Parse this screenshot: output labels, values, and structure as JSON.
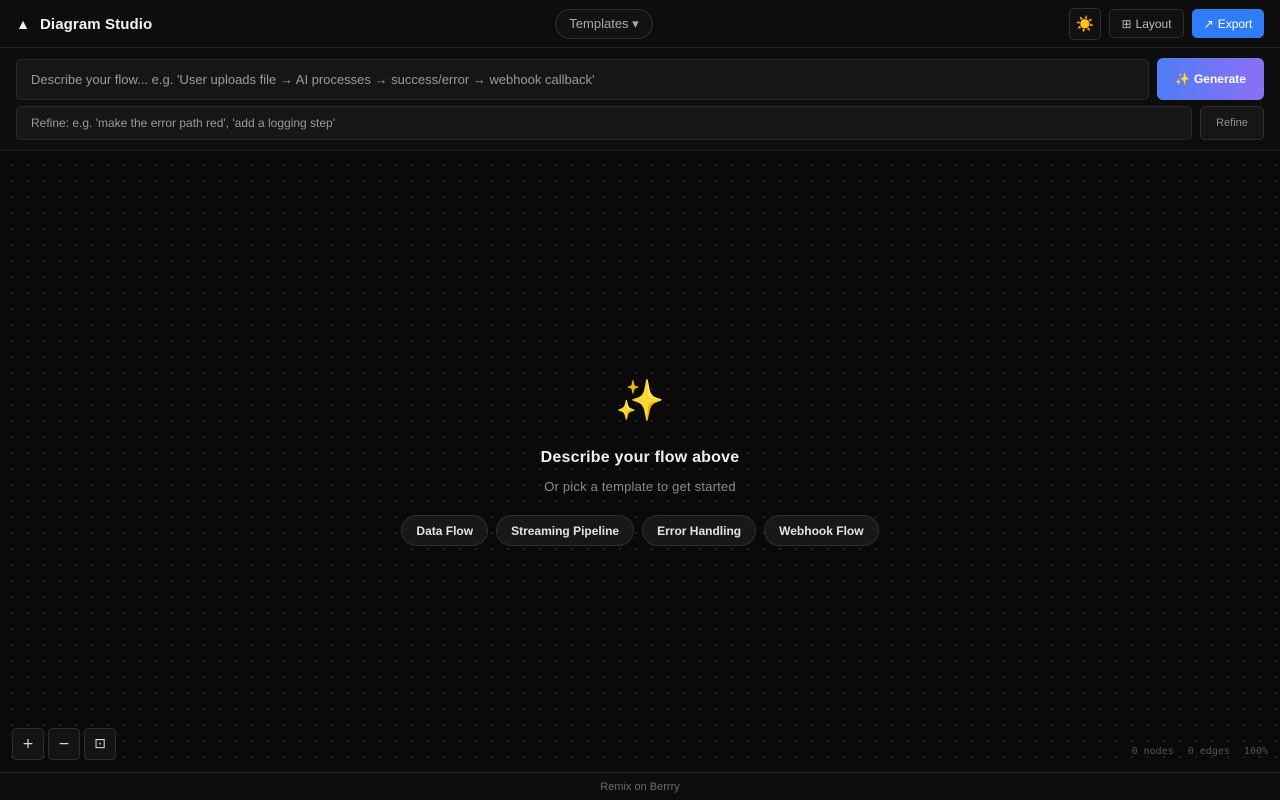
{
  "header": {
    "logo_icon": "▲",
    "title": "Diagram Studio",
    "templates_label": "Templates ▾",
    "theme_icon": "☀️",
    "layout_icon": "⊞",
    "layout_label": "Layout",
    "export_icon": "↗",
    "export_label": "Export"
  },
  "prompt": {
    "describe_placeholder": "Describe your flow... e.g. 'User uploads file → AI processes → success/error → webhook callback'",
    "describe_value": "",
    "generate_icon": "✨",
    "generate_label": "Generate",
    "refine_placeholder": "Refine: e.g. 'make the error path red', 'add a logging step'",
    "refine_value": "",
    "refine_label": "Refine"
  },
  "canvas": {
    "empty_icon": "✨",
    "empty_title": "Describe your flow above",
    "empty_subtitle": "Or pick a template to get started",
    "templates": [
      {
        "label": "Data Flow"
      },
      {
        "label": "Streaming Pipeline"
      },
      {
        "label": "Error Handling"
      },
      {
        "label": "Webhook Flow"
      }
    ],
    "zoom_in": "+",
    "zoom_out": "−",
    "fit_view": "⊡",
    "stats": {
      "nodes": "0 nodes",
      "edges": "0 edges",
      "zoom": "100%"
    }
  },
  "footer": {
    "link_text": "Remix on Berrry"
  },
  "colors": {
    "background": "#0b0b0b",
    "accent_blue": "#2f7cf6",
    "gradient_start": "#4f7df5",
    "gradient_end": "#8b6ff6",
    "sparkle": "#f6c343"
  }
}
